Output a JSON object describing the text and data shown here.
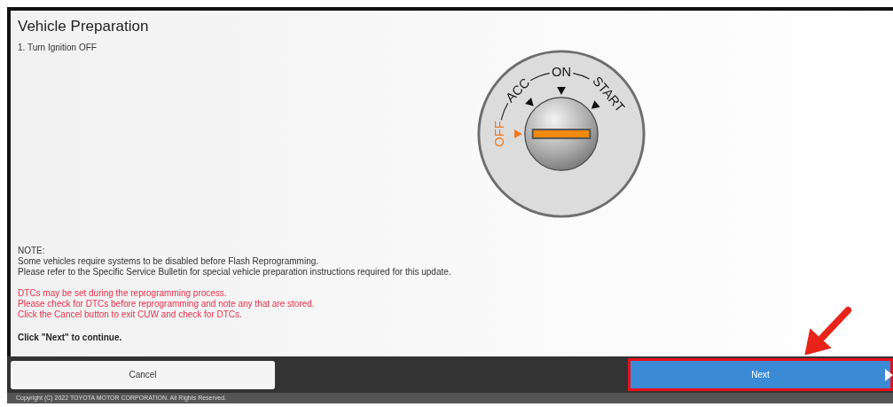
{
  "title": "Vehicle Preparation",
  "step": "1. Turn Ignition OFF",
  "ignition_positions": [
    {
      "label": "OFF",
      "selected": true
    },
    {
      "label": "ACC",
      "selected": false
    },
    {
      "label": "ON",
      "selected": false
    },
    {
      "label": "START",
      "selected": false
    }
  ],
  "note_lines": [
    "NOTE:",
    "Some vehicles require systems to be disabled before Flash Reprogramming.",
    "Please refer to the Specific Service Bulletin for special vehicle preparation instructions required for this update."
  ],
  "warning_lines": [
    "DTCs may be set during the reprogramming process.",
    "Please check for DTCs before reprogramming and note any that are stored.",
    "Click the Cancel button to exit CUW and check for DTCs."
  ],
  "instruction": "Click \"Next\" to continue.",
  "buttons": [
    {
      "label": "Cancel",
      "kind": "secondary",
      "highlighted": false
    },
    {
      "label": "Next",
      "kind": "primary",
      "highlighted": true
    }
  ],
  "copyright": "Copyright (C) 2022 TOYOTA MOTOR CORPORATION. All Rights Reserved."
}
